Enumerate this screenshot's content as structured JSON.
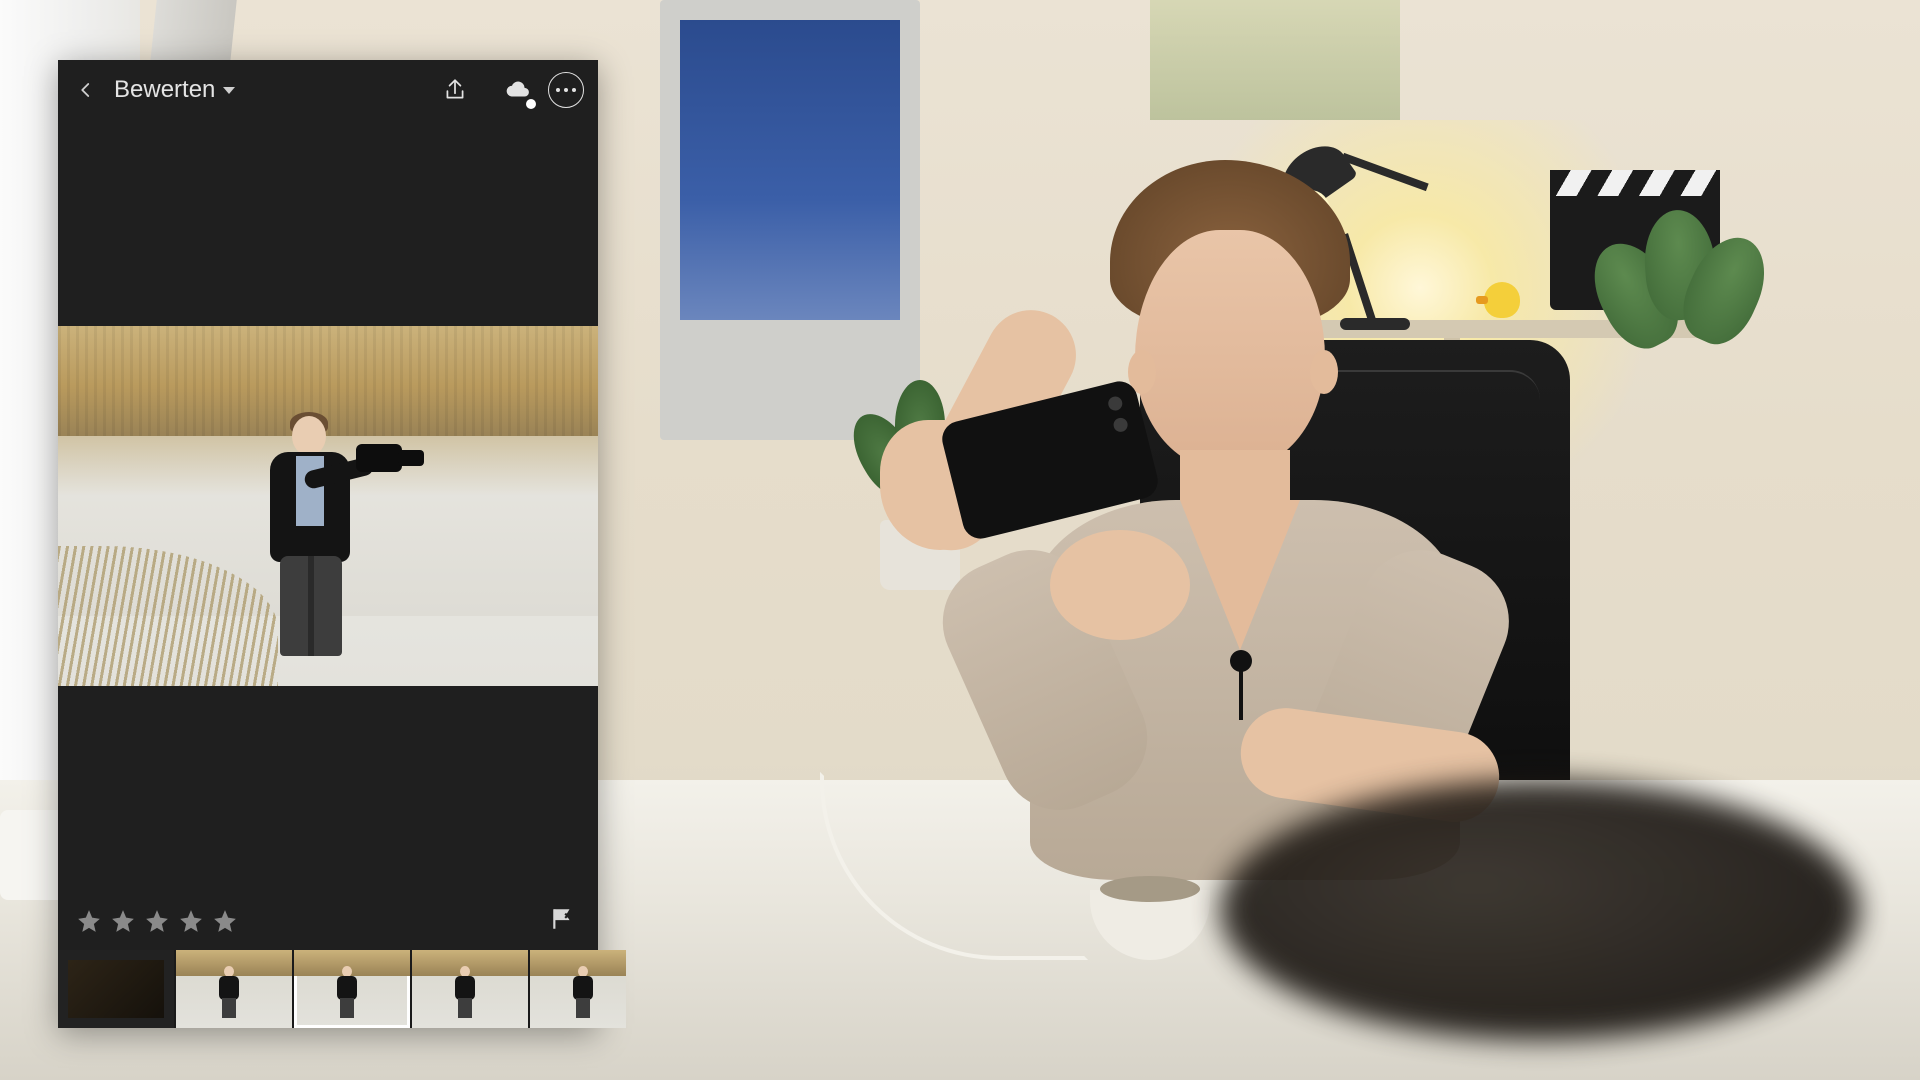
{
  "app": {
    "mode_label": "Bewerten",
    "icons": {
      "back": "chevron-left-icon",
      "share": "share-icon",
      "cloud": "cloud-sync-icon",
      "more": "more-horizontal-icon",
      "flag": "flag-icon",
      "star": "star-icon"
    },
    "rating": {
      "stars_total": 5,
      "stars_filled": 0
    },
    "filmstrip": {
      "selected_index": 2,
      "count_visible": 5
    }
  }
}
